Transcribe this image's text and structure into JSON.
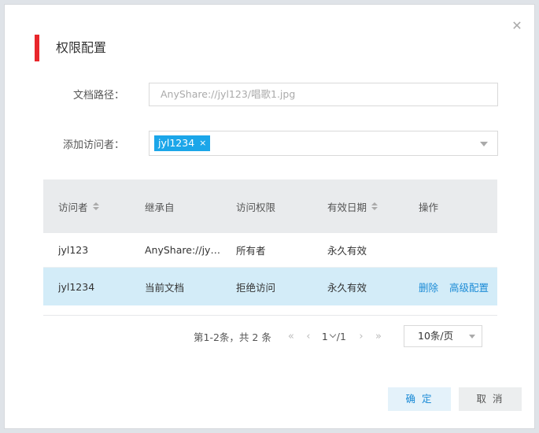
{
  "dialog": {
    "title": "权限配置",
    "close_icon": "close-icon",
    "accent_color": "#e8262b"
  },
  "form": {
    "path_label": "文档路径：",
    "path_value": "AnyShare://jyl123/唱歌1.jpg",
    "visitor_label": "添加访问者：",
    "visitor_tags": [
      {
        "label": "jyl1234",
        "remove": "×"
      }
    ]
  },
  "table": {
    "columns": [
      "访问者",
      "继承自",
      "访问权限",
      "有效日期",
      "操作"
    ],
    "sortable_columns": [
      "访问者",
      "有效日期"
    ],
    "rows": [
      {
        "visitor": "jyl123",
        "inherit": "AnyShare://jyl...",
        "permission": "所有者",
        "expiry": "永久有效",
        "actions": []
      },
      {
        "visitor": "jyl1234",
        "inherit": "当前文档",
        "permission": "拒绝访问",
        "expiry": "永久有效",
        "actions": [
          "删除",
          "高级配置"
        ],
        "selected": true
      }
    ]
  },
  "pagination": {
    "summary": "第1-2条，共 2 条",
    "first": "«",
    "prev": "‹",
    "current": "1",
    "total": "/1",
    "next": "›",
    "last": "»",
    "page_size": "10条/页"
  },
  "buttons": {
    "ok": "确 定",
    "cancel": "取 消"
  },
  "colors": {
    "tag": "#1ba6e9",
    "link": "#1b8bd6",
    "selected_row": "#d3ecf8"
  }
}
